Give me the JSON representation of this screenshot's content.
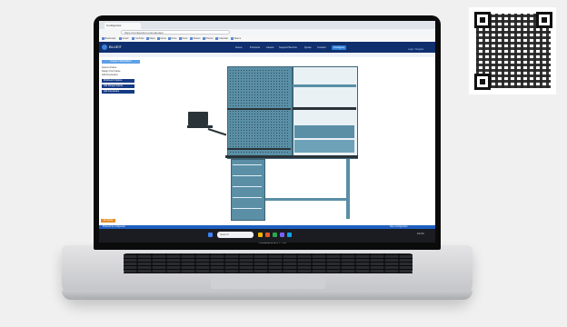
{
  "device": {
    "brand_label": "MacBook Pro"
  },
  "browser": {
    "tab_title": "Configurator",
    "url": "https://configurator.example/app",
    "bookmarks": [
      "Bookmark",
      "Gmail",
      "YouTube",
      "Maps",
      "News",
      "Drive",
      "Docs",
      "Sheets",
      "Photos",
      "Calendar",
      "Teams"
    ]
  },
  "app": {
    "logo_text": "BLUEIT",
    "nav_items": [
      "Home",
      "Products",
      "Assets",
      "Support/Service",
      "Quote",
      "Contact",
      "Configure"
    ],
    "active_nav_index": 6,
    "header_right_link": "Login / Register",
    "sidebar": {
      "header": "Create a Workstation",
      "lines": [
        "Select a Frame",
        "Design Your Frame",
        "Add Accessories"
      ],
      "buttons": [
        "Workbench Options",
        "Add Storage Options",
        "Add Accessories"
      ],
      "orange_button": "Get Quote"
    },
    "status_bar_text": "Powered by configurator",
    "status_bar_right": "Save Configuration"
  },
  "taskbar": {
    "search_placeholder": "Search",
    "time": "10:24"
  },
  "colors": {
    "nav_bg": "#0f2f6e",
    "accent": "#2e7dd8",
    "steel": "#5a8fa6",
    "orange": "#e38b26"
  }
}
